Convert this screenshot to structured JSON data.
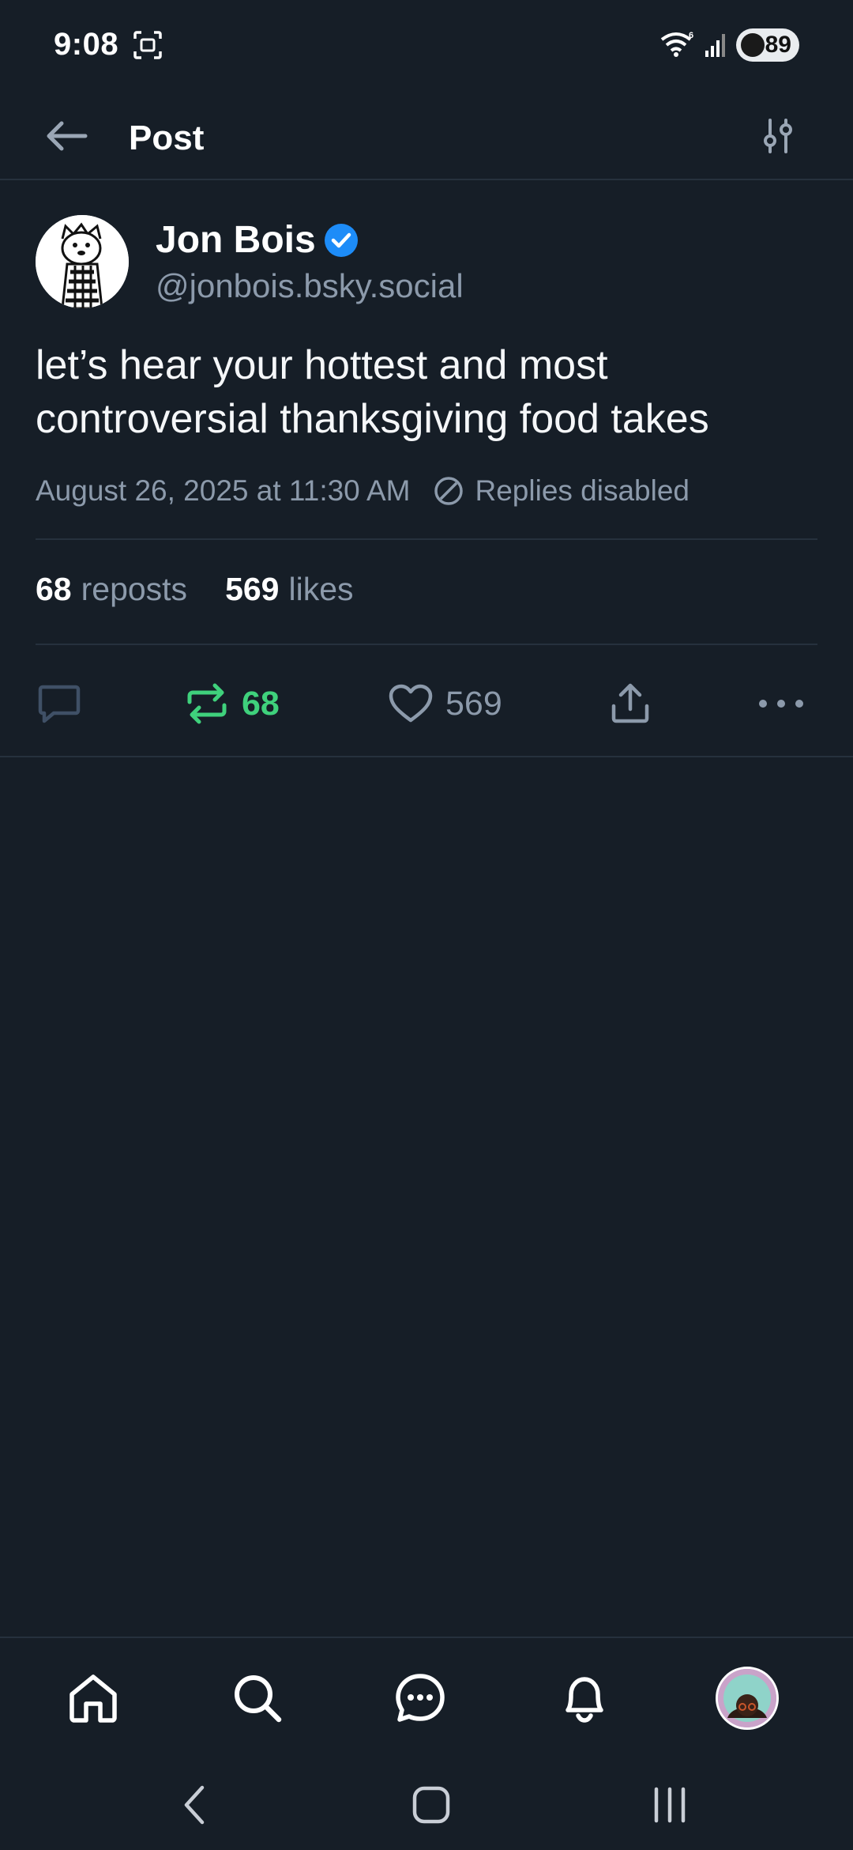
{
  "status_bar": {
    "time": "9:08",
    "battery": "89"
  },
  "header": {
    "title": "Post"
  },
  "post": {
    "author_name": "Jon Bois",
    "author_handle": "@jonbois.bsky.social",
    "text": "let’s hear your hottest and most controversial thanksgiving food takes",
    "timestamp": "August 26, 2025 at 11:30 AM",
    "replies_status": "Replies disabled",
    "stats": {
      "reposts_count": "68",
      "reposts_label": "reposts",
      "likes_count": "569",
      "likes_label": "likes"
    },
    "actions": {
      "repost_count": "68",
      "like_count": "569"
    }
  },
  "colors": {
    "background": "#161e27",
    "divider": "#26313d",
    "muted_text": "#8c9aab",
    "repost_active": "#3fd17c",
    "verified": "#1d8cf8"
  },
  "icons": {
    "back": "arrow-left-icon",
    "filter": "sliders-icon",
    "verified": "verified-check-icon",
    "replies_disabled": "circle-slash-icon",
    "reply": "speech-bubble-icon",
    "repost": "repost-arrows-icon",
    "like": "heart-icon",
    "share": "share-upload-icon",
    "more": "more-horizontal-icon",
    "nav": [
      "home-icon",
      "search-icon",
      "chat-icon",
      "bell-icon",
      "profile-avatar"
    ]
  }
}
